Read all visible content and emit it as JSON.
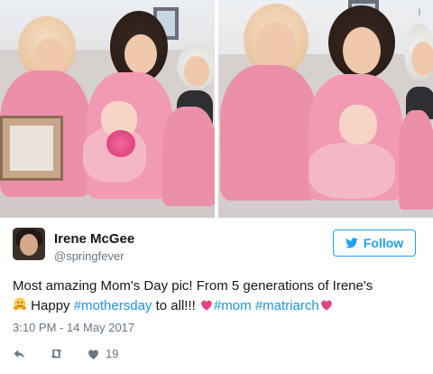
{
  "photos": {
    "left_alt": "",
    "right_alt": "",
    "info_badge": "i"
  },
  "author": {
    "display_name": "Irene McGee",
    "handle": "@springfever"
  },
  "follow_button": {
    "label": "Follow"
  },
  "tweet": {
    "line1": "Most amazing Mom's Day pic! From 5 generations of Irene's",
    "part_happy": "Happy",
    "hashtag_mothersday": "#mothersday",
    "part_to_all": "to all!!!",
    "hashtag_mom": "#mom",
    "hashtag_matriarch": "#matriarch"
  },
  "timestamp": "3:10 PM - 14 May 2017",
  "actions": {
    "likes_count": "19"
  },
  "colors": {
    "accent": "#1da1f2",
    "hashtag": "#1b95e0",
    "muted": "#657786",
    "heart_emoji": "#e0457f"
  },
  "icons": [
    "info-icon",
    "bird-icon",
    "reply-icon",
    "retweet-icon",
    "heart-icon",
    "hugging-face-emoji",
    "sparkling-heart-emoji"
  ]
}
